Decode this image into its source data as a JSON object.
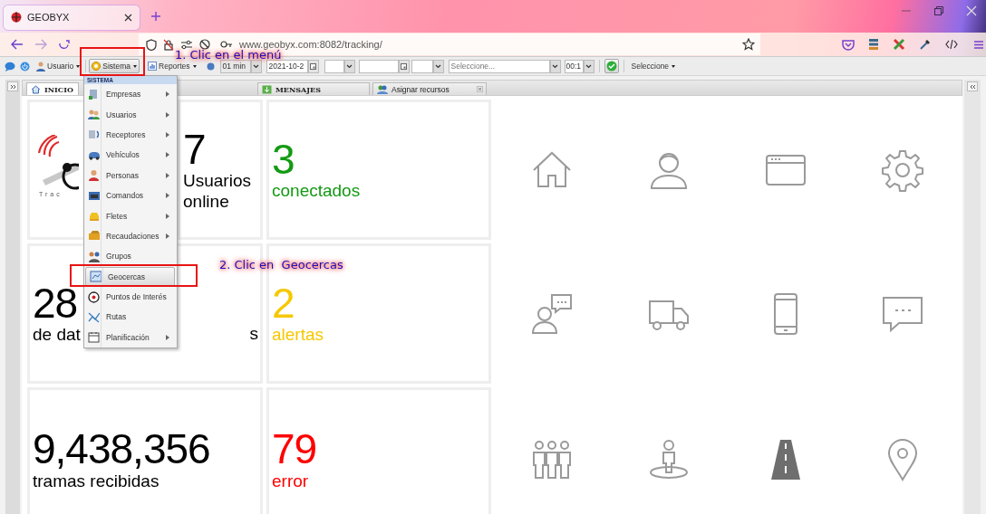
{
  "browser": {
    "tab": {
      "title": "GEOBYX",
      "selected": true
    },
    "url": "www.geobyx.com:8082/tracking/"
  },
  "toolbar": {
    "user_menu": "Usuario",
    "system_menu": {
      "label": "Sistema",
      "selected": true
    },
    "reports_menu": "Reportes",
    "interval": "01 min",
    "date": "2021-10-2",
    "vehicle_select": {
      "placeholder": "Seleccione..."
    },
    "time": "00:1",
    "filter_menu": "Seleccione"
  },
  "tabs": [
    {
      "label": "INICIO",
      "selected": true,
      "closable": false
    },
    {
      "label": "MENSAJES",
      "selected": false,
      "closable": false
    },
    {
      "label": "Asignar recursos",
      "selected": false,
      "closable": true
    }
  ],
  "dashboard": {
    "logo_text": "Trac",
    "cards": [
      {
        "value": "7",
        "label": "Usuarios online",
        "color": "#000000"
      },
      {
        "value": "3",
        "label": "conectados",
        "color": "#139a13"
      },
      {
        "value": "28",
        "label": "de dat",
        "label_end": "s",
        "color": "#000000"
      },
      {
        "value": "2",
        "label": "alertas",
        "color": "#f5c800"
      },
      {
        "value": "9,438,356",
        "label": "tramas recibidas",
        "color": "#000000"
      },
      {
        "value": "79",
        "label": "error",
        "color": "#ff0000"
      }
    ]
  },
  "system_menu": {
    "header": "SISTEMA",
    "items": [
      {
        "label": "Empresas",
        "submenu": true,
        "selected": false
      },
      {
        "label": "Usuarios",
        "submenu": true,
        "selected": false
      },
      {
        "label": "Receptores",
        "submenu": true,
        "selected": false
      },
      {
        "label": "Vehículos",
        "submenu": true,
        "selected": false
      },
      {
        "label": "Personas",
        "submenu": true,
        "selected": false
      },
      {
        "label": "Comandos",
        "submenu": true,
        "selected": false
      },
      {
        "label": "Fletes",
        "submenu": true,
        "selected": false
      },
      {
        "label": "Recaudaciones",
        "submenu": true,
        "selected": false
      },
      {
        "label": "Grupos",
        "submenu": false,
        "selected": false
      },
      {
        "label": "Geocercas",
        "submenu": false,
        "selected": true
      },
      {
        "label": "Puntos de Interés",
        "submenu": false,
        "selected": false
      },
      {
        "label": "Rutas",
        "submenu": false,
        "selected": false
      },
      {
        "label": "Planificación",
        "submenu": true,
        "selected": false
      }
    ]
  },
  "annotations": [
    {
      "text": "1. Clic en el menú"
    },
    {
      "text": "2. Clic en  Geocercas"
    }
  ]
}
